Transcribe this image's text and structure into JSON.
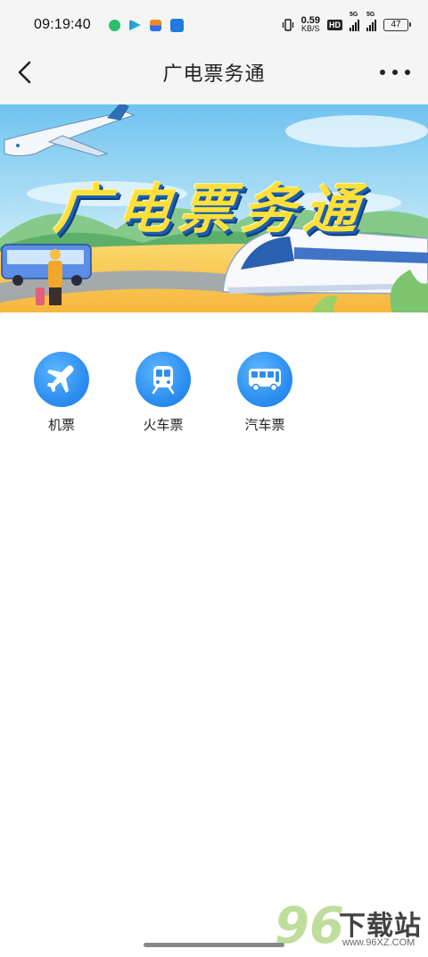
{
  "status_bar": {
    "time": "09:19:40",
    "net_speed_value": "0.59",
    "net_speed_unit": "KB/S",
    "hd_label": "HD",
    "signal1_label": "5G",
    "signal2_label": "5G",
    "battery_level": "47"
  },
  "nav": {
    "title": "广电票务通"
  },
  "banner": {
    "title": "广电票务通"
  },
  "menu": {
    "items": [
      {
        "label": "机票",
        "icon": "airplane-icon"
      },
      {
        "label": "火车票",
        "icon": "train-icon"
      },
      {
        "label": "汽车票",
        "icon": "bus-icon"
      }
    ]
  },
  "watermark": {
    "number": "96",
    "name": "下载站",
    "url": "www.96XZ.COM"
  },
  "colors": {
    "accent": "#2d8ff0",
    "banner_title": "#ffe03a",
    "background": "#f5f5f5"
  }
}
